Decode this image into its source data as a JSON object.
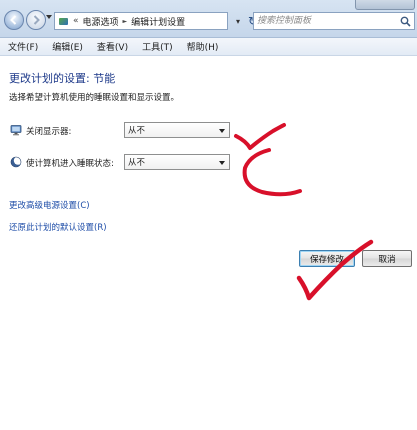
{
  "addressbar": {
    "breadcrumbs": [
      "电源选项",
      "编辑计划设置"
    ],
    "overflow_glyph": "«",
    "separator_glyph": "►",
    "search_placeholder": "搜索控制面板"
  },
  "menu": {
    "items": [
      "文件(F)",
      "编辑(E)",
      "查看(V)",
      "工具(T)",
      "帮助(H)"
    ]
  },
  "page": {
    "title": "更改计划的设置: 节能",
    "subtitle": "选择希望计算机使用的睡眠设置和显示设置。"
  },
  "settings": [
    {
      "label": "关闭显示器:",
      "value": "从不",
      "icon": "monitor-icon"
    },
    {
      "label": "使计算机进入睡眠状态:",
      "value": "从不",
      "icon": "moon-icon"
    }
  ],
  "links": {
    "advanced": "更改高级电源设置(C)",
    "restore": "还原此计划的默认设置(R)"
  },
  "buttons": {
    "save": "保存修改",
    "cancel": "取消"
  },
  "annotation_color": "#d8102a"
}
